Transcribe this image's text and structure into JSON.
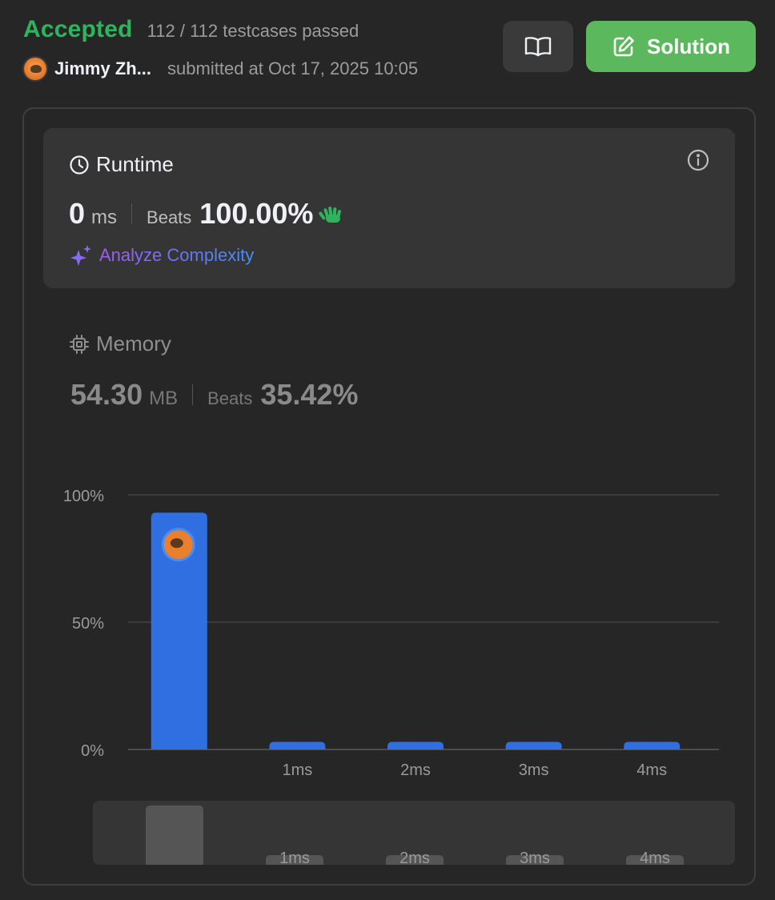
{
  "header": {
    "verdict": "Accepted",
    "testcases": "112 / 112 testcases passed",
    "submitter_name": "Jimmy Zh...",
    "submitted_at": "submitted at Oct 17, 2025 10:05",
    "editorial_icon": "book-open-icon",
    "solution_label": "Solution"
  },
  "runtime": {
    "title": "Runtime",
    "value": "0",
    "unit": "ms",
    "beats_label": "Beats",
    "beats_pct": "100.00%",
    "badge_icon": "clapping-hands-icon",
    "analyze_label": "Analyze Complexity"
  },
  "memory": {
    "title": "Memory",
    "value": "54.30",
    "unit": "MB",
    "beats_label": "Beats",
    "beats_pct": "35.42%"
  },
  "colors": {
    "accepted": "#2db55d",
    "solution_button": "#5cb85c",
    "bar": "#2f6fe1",
    "bar_muted": "#555555"
  },
  "chart_data": {
    "type": "bar",
    "categories": [
      "",
      "1ms",
      "2ms",
      "3ms",
      "4ms"
    ],
    "values": [
      93,
      3,
      3,
      3,
      3
    ],
    "ylim": [
      0,
      100
    ],
    "yticks": [
      "0%",
      "50%",
      "100%"
    ],
    "ytick_values": [
      0,
      50,
      100
    ],
    "highlight_index": 0,
    "grid": true
  },
  "navigator": {
    "categories": [
      "",
      "1ms",
      "2ms",
      "3ms",
      "4ms"
    ],
    "values": [
      93,
      3,
      3,
      3,
      3
    ]
  }
}
